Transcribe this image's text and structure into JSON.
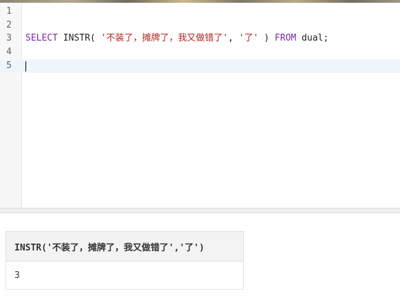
{
  "editor": {
    "line_numbers": [
      "1",
      "2",
      "3",
      "4",
      "5"
    ],
    "sql": {
      "kw_select": "SELECT",
      "func_part": " INSTR( ",
      "string1": "'不装了，摊牌了，我又做错了'",
      "comma": ", ",
      "string2": "'了'",
      "close_paren": " ) ",
      "kw_from": "FROM",
      "tail": " dual;"
    },
    "cursor_line": 5
  },
  "results": {
    "columns": [
      "INSTR('不装了，摊牌了，我又做错了','了')"
    ],
    "rows": [
      [
        "3"
      ]
    ]
  },
  "colors": {
    "keyword": "#7a2aa8",
    "string": "#b3261e",
    "active_line": "#eef6fc"
  }
}
